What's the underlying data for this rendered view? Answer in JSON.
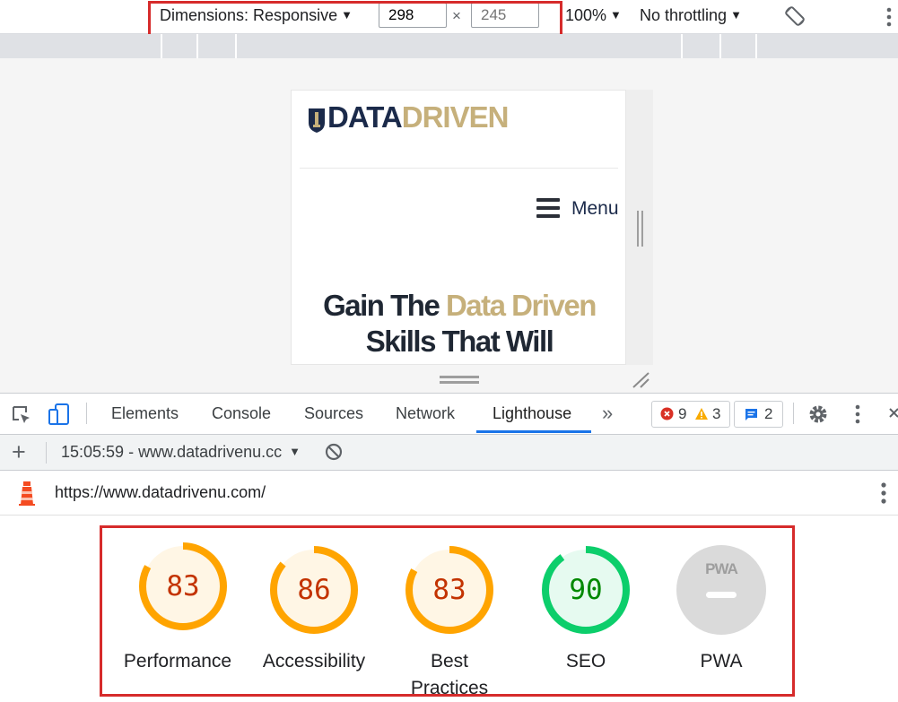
{
  "device_toolbar": {
    "dimensions_label": "Dimensions: Responsive",
    "width": "298",
    "height_placeholder": "245",
    "times": "×",
    "zoom": "100%",
    "throttling": "No throttling",
    "caret": "▼"
  },
  "site": {
    "logo_word1": "DATA",
    "logo_word2": "DRIVEN",
    "menu_label": "Menu",
    "hero_line1_a": "Gain The ",
    "hero_line1_b": "Data Driven",
    "hero_line2": "Skills That Will"
  },
  "devtools": {
    "tabs": [
      "Elements",
      "Console",
      "Sources",
      "Network",
      "Lighthouse"
    ],
    "more": "»",
    "errors": "9",
    "warnings": "3",
    "messages": "2",
    "report_time_url": "15:05:59 - www.datadrivenu.cc",
    "add": "+",
    "url": "https://www.datadrivenu.com/"
  },
  "scores": [
    {
      "label": "Performance",
      "value": 83,
      "color": "#ffa400"
    },
    {
      "label": "Accessibility",
      "value": 86,
      "color": "#ffa400"
    },
    {
      "label": "Best Practices",
      "value": 83,
      "color": "#ffa400"
    },
    {
      "label": "SEO",
      "value": 90,
      "color": "#0cce6b"
    },
    {
      "label": "PWA",
      "value": null,
      "color": "#bdbdbd",
      "badge": "PWA"
    }
  ],
  "colors": {
    "accent": "#1a73e8",
    "highlight": "#d62b2b",
    "gold": "#c6b07b",
    "navy": "#1b2a4a"
  }
}
